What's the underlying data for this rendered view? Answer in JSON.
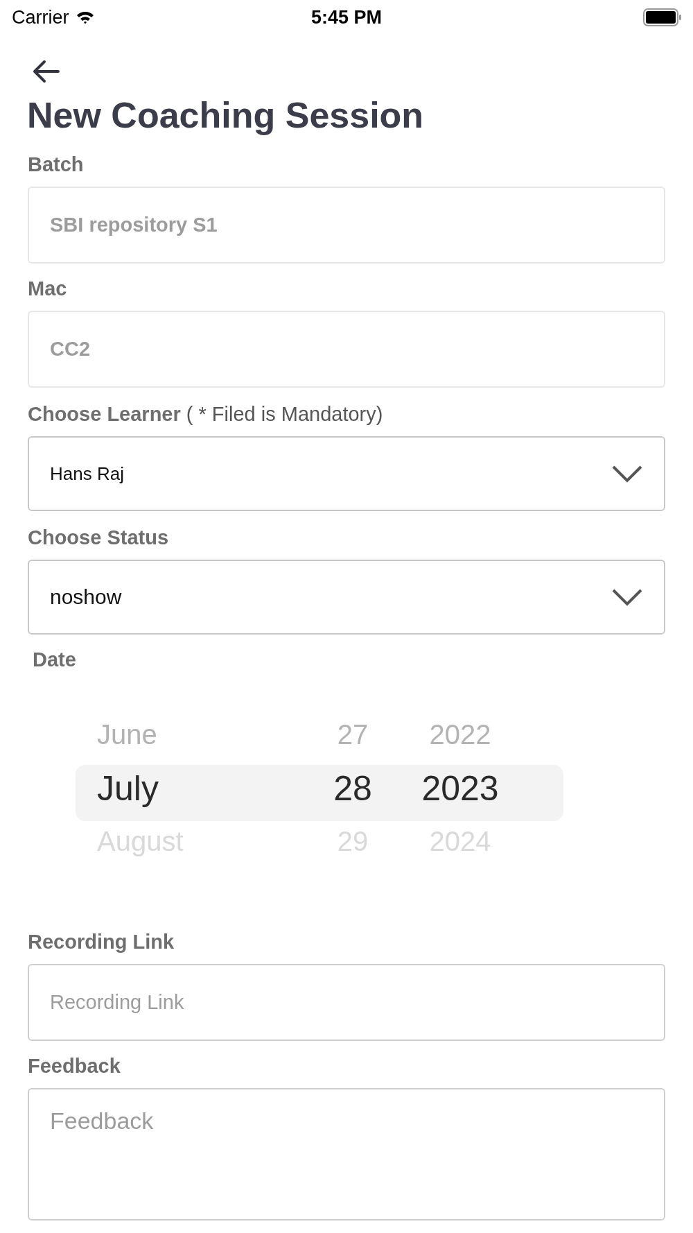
{
  "status_bar": {
    "carrier": "Carrier",
    "time": "5:45 PM"
  },
  "title": "New Coaching Session",
  "fields": [
    {
      "kind": "input",
      "label": "Batch",
      "value": "SBI repository S1",
      "disabled": true
    },
    {
      "kind": "input",
      "label": "Mac",
      "value": "CC2",
      "disabled": true
    },
    {
      "kind": "select",
      "label": "Choose Learner",
      "note": "( * Filed is Mandatory)",
      "value": "Hans Raj"
    },
    {
      "kind": "select",
      "label": "Choose Status",
      "value": "noshow"
    },
    {
      "kind": "date",
      "label": "Date",
      "rows": [
        {
          "month": "June",
          "day": "27",
          "year": "2022",
          "selected": false
        },
        {
          "month": "July",
          "day": "28",
          "year": "2023",
          "selected": true
        },
        {
          "month": "August",
          "day": "29",
          "year": "2024",
          "selected": false
        }
      ]
    },
    {
      "kind": "input",
      "label": "Recording Link",
      "placeholder": "Recording Link",
      "disabled": false
    },
    {
      "kind": "textarea",
      "label": "Feedback",
      "placeholder": "Feedback"
    }
  ]
}
